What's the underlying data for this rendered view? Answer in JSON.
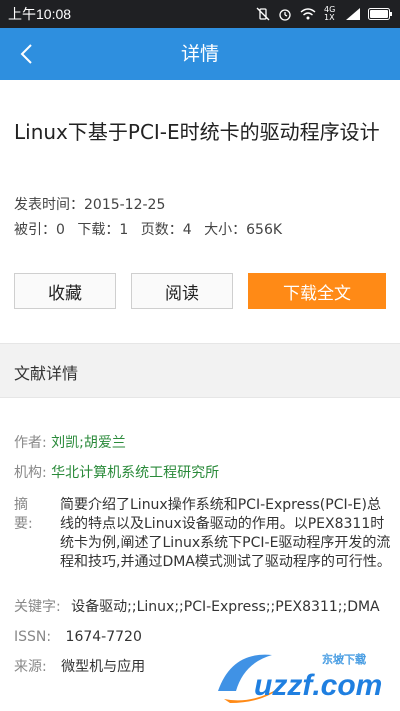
{
  "status": {
    "time": "上午10:08",
    "network": "4G 1X"
  },
  "appbar": {
    "title": "详情"
  },
  "doc": {
    "title": "Linux下基于PCI-E时统卡的驱动程序设计",
    "publish_label": "发表时间：",
    "publish_date": "2015-12-25",
    "cited": "被引：0",
    "downloads": "下载：1",
    "pages": "页数：4",
    "size": "大小：656K"
  },
  "buttons": {
    "favorite": "收藏",
    "read": "阅读",
    "download": "下载全文"
  },
  "detail": {
    "heading": "文献详情",
    "author_label": "作者:",
    "author": "刘凯;胡爱兰",
    "org_label": "机构:",
    "org": "华北计算机系统工程研究所",
    "abstract_label": "摘要:",
    "abstract": "简要介绍了Linux操作系统和PCI-Express(PCI-E)总线的特点以及Linux设备驱动的作用。以PEX8311时统卡为例,阐述了Linux系统下PCI-E驱动程序开发的流程和技巧,并通过DMA模式测试了驱动程序的可行性。",
    "keywords_label": "关键字:",
    "keywords": "设备驱动;;Linux;;PCI-Express;;PEX8311;;DMA",
    "issn_label": "ISSN:",
    "issn": "1674-7720",
    "source_label": "来源:",
    "source": "微型机与应用"
  },
  "watermark": {
    "brand": "uzzf.com",
    "cn": "东坡下载"
  },
  "colors": {
    "appbar": "#2e8fdf",
    "download_button": "#ff8a16",
    "link_green": "#2a8a3a"
  }
}
